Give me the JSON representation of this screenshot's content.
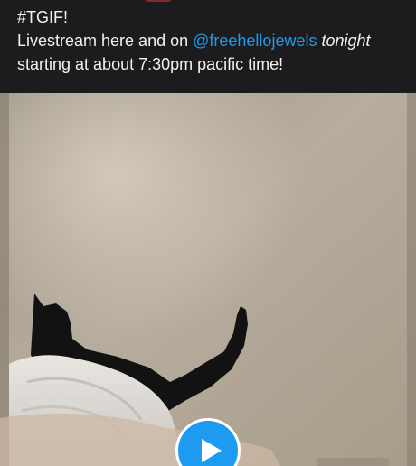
{
  "post": {
    "hashtag_line": "#TGIF!",
    "line2_prefix": "Livestream here and on ",
    "mention": "@freehellojewels",
    "line2_suffix_italic": "tonight",
    "line3": "starting at about 7:30pm pacific time!"
  },
  "media": {
    "type": "video",
    "play_icon": "play-icon",
    "accent_color": "#1d9bf0"
  }
}
